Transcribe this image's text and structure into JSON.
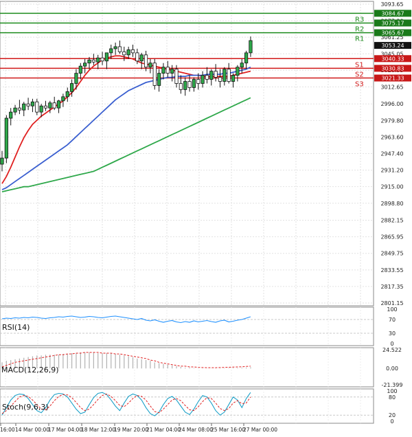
{
  "chart_data": {
    "type": "line",
    "main": {
      "y_axis_ticks": [
        "3093.65",
        "3077.30",
        "3061.25",
        "3045.05",
        "3028.95",
        "3012.65",
        "2996.00",
        "2979.80",
        "2963.60",
        "2947.40",
        "2931.20",
        "2915.00",
        "2898.80",
        "2882.15",
        "2865.95",
        "2849.75",
        "2833.55",
        "2817.35",
        "2801.15"
      ],
      "ylim": [
        2801.15,
        3093.65
      ],
      "current_price": "3053.24",
      "resistance_levels": [
        {
          "label": "R3",
          "value": 3084.67,
          "price_tag": "3084.67"
        },
        {
          "label": "R2",
          "value": 3075.17,
          "price_tag": "3075.17"
        },
        {
          "label": "R1",
          "value": 3065.67,
          "price_tag": "3065.67"
        }
      ],
      "support_levels": [
        {
          "label": "S1",
          "value": 3040.33,
          "price_tag": "3040.33"
        },
        {
          "label": "S2",
          "value": 3030.83,
          "price_tag": "3030.83"
        },
        {
          "label": "S3",
          "value": 3021.33,
          "price_tag": "3021.33"
        }
      ],
      "candles_ohlc": [
        [
          2937,
          2950,
          2930,
          2943
        ],
        [
          2943,
          2985,
          2938,
          2982
        ],
        [
          2982,
          2992,
          2975,
          2988
        ],
        [
          2988,
          2995,
          2985,
          2992
        ],
        [
          2992,
          3000,
          2986,
          2990
        ],
        [
          2990,
          2998,
          2984,
          2996
        ],
        [
          2996,
          3002,
          2990,
          2994
        ],
        [
          2994,
          3001,
          2988,
          2998
        ],
        [
          2998,
          3001,
          2985,
          2988
        ],
        [
          2988,
          2996,
          2983,
          2994
        ],
        [
          2994,
          2999,
          2989,
          2992
        ],
        [
          2992,
          2999,
          2987,
          2997
        ],
        [
          2997,
          3003,
          2990,
          2992
        ],
        [
          2992,
          3000,
          2987,
          2999
        ],
        [
          2999,
          3006,
          2993,
          3003
        ],
        [
          3003,
          3012,
          2998,
          3008
        ],
        [
          3008,
          3020,
          3003,
          3016
        ],
        [
          3016,
          3030,
          3010,
          3026
        ],
        [
          3026,
          3036,
          3020,
          3033
        ],
        [
          3033,
          3040,
          3026,
          3036
        ],
        [
          3036,
          3042,
          3030,
          3039
        ],
        [
          3039,
          3045,
          3034,
          3037
        ],
        [
          3037,
          3044,
          3030,
          3041
        ],
        [
          3041,
          3047,
          3034,
          3038
        ],
        [
          3038,
          3044,
          3030,
          3046
        ],
        [
          3046,
          3054,
          3040,
          3050
        ],
        [
          3050,
          3056,
          3044,
          3052
        ],
        [
          3052,
          3058,
          3045,
          3047
        ],
        [
          3047,
          3052,
          3038,
          3044
        ],
        [
          3044,
          3052,
          3040,
          3049
        ],
        [
          3049,
          3054,
          3042,
          3046
        ],
        [
          3046,
          3050,
          3035,
          3038
        ],
        [
          3038,
          3046,
          3030,
          3044
        ],
        [
          3044,
          3048,
          3028,
          3032
        ],
        [
          3032,
          3040,
          3026,
          3036
        ],
        [
          3036,
          3040,
          3010,
          3014
        ],
        [
          3014,
          3030,
          3008,
          3026
        ],
        [
          3026,
          3036,
          3020,
          3032
        ],
        [
          3032,
          3038,
          3022,
          3026
        ],
        [
          3026,
          3034,
          3018,
          3030
        ],
        [
          3030,
          3034,
          3012,
          3016
        ],
        [
          3016,
          3024,
          3006,
          3010
        ],
        [
          3010,
          3022,
          3004,
          3018
        ],
        [
          3018,
          3024,
          3008,
          3012
        ],
        [
          3012,
          3022,
          3008,
          3020
        ],
        [
          3020,
          3026,
          3010,
          3016
        ],
        [
          3016,
          3028,
          3012,
          3024
        ],
        [
          3024,
          3032,
          3016,
          3020
        ],
        [
          3020,
          3030,
          3014,
          3028
        ],
        [
          3028,
          3035,
          3018,
          3022
        ],
        [
          3022,
          3030,
          3012,
          3018
        ],
        [
          3018,
          3032,
          3014,
          3030
        ],
        [
          3030,
          3036,
          3016,
          3018
        ],
        [
          3018,
          3026,
          3012,
          3024
        ],
        [
          3024,
          3034,
          3018,
          3032
        ],
        [
          3032,
          3040,
          3026,
          3036
        ],
        [
          3036,
          3048,
          3030,
          3046
        ],
        [
          3046,
          3062,
          3042,
          3058
        ]
      ],
      "moving_averages": [
        {
          "color": "#e02020",
          "values": [
            2918,
            2925,
            2934,
            2944,
            2954,
            2963,
            2970,
            2976,
            2980,
            2984,
            2987,
            2990,
            2993,
            2996,
            2999,
            3003,
            3007,
            3012,
            3018,
            3024,
            3029,
            3033,
            3036,
            3039,
            3041,
            3042,
            3043,
            3043,
            3042,
            3041,
            3040,
            3038,
            3036,
            3035,
            3034,
            3033,
            3032,
            3031,
            3030,
            3029,
            3028,
            3027,
            3026,
            3025,
            3024,
            3024,
            3023,
            3023,
            3023,
            3023,
            3023,
            3023,
            3023,
            3024,
            3025,
            3026,
            3027,
            3028
          ]
        },
        {
          "color": "#3a5fd0",
          "values": [
            2912,
            2914,
            2917,
            2920,
            2923,
            2926,
            2929,
            2932,
            2935,
            2938,
            2941,
            2944,
            2947,
            2950,
            2953,
            2956,
            2960,
            2964,
            2968,
            2972,
            2976,
            2980,
            2984,
            2988,
            2992,
            2996,
            3000,
            3003,
            3006,
            3009,
            3011,
            3013,
            3015,
            3017,
            3018,
            3019,
            3020,
            3021,
            3022,
            3022,
            3023,
            3023,
            3023,
            3024,
            3024,
            3024,
            3024,
            3025,
            3025,
            3025,
            3025,
            3026,
            3026,
            3027,
            3028,
            3029,
            3030,
            3032
          ]
        },
        {
          "color": "#2ea84a",
          "values": [
            2910,
            2911,
            2912,
            2913,
            2914,
            2915,
            2915,
            2916,
            2917,
            2918,
            2919,
            2920,
            2921,
            2922,
            2923,
            2924,
            2925,
            2926,
            2927,
            2928,
            2929,
            2930,
            2932,
            2934,
            2936,
            2938,
            2940,
            2942,
            2944,
            2946,
            2948,
            2950,
            2952,
            2954,
            2956,
            2958,
            2960,
            2962,
            2964,
            2966,
            2968,
            2970,
            2972,
            2974,
            2976,
            2978,
            2980,
            2982,
            2984,
            2986,
            2988,
            2990,
            2992,
            2994,
            2996,
            2998,
            3000,
            3002
          ]
        }
      ]
    },
    "x_axis_labels": [
      "16:00",
      "14 Mar 00:00",
      "17 Mar 04:00",
      "18 Mar 12:00",
      "19 Mar 20:00",
      "21 Mar 04:00",
      "24 Mar 08:00",
      "25 Mar 16:00",
      "27 Mar 00:00"
    ],
    "rsi": {
      "title": "RSI(14)",
      "ticks": [
        "100",
        "70",
        "30",
        "0"
      ],
      "values": [
        72,
        74,
        73,
        75,
        74,
        76,
        75,
        77,
        76,
        74,
        73,
        75,
        76,
        78,
        77,
        79,
        80,
        78,
        76,
        77,
        79,
        78,
        76,
        75,
        77,
        79,
        80,
        78,
        76,
        74,
        72,
        70,
        73,
        68,
        66,
        69,
        65,
        62,
        65,
        67,
        63,
        61,
        64,
        62,
        66,
        63,
        65,
        67,
        64,
        62,
        66,
        68,
        63,
        65,
        68,
        70,
        74,
        78
      ],
      "ylim": [
        0,
        100
      ]
    },
    "macd": {
      "title": "MACD(12,26,9)",
      "ticks": [
        "24.522",
        "0.00",
        "-21.399"
      ],
      "histogram": [
        8,
        10,
        11,
        12,
        13,
        14,
        15,
        16,
        17,
        17,
        18,
        18,
        18,
        18,
        19,
        19,
        20,
        20,
        21,
        21,
        21,
        21,
        20,
        20,
        20,
        20,
        19,
        18,
        17,
        16,
        15,
        13,
        12,
        11,
        10,
        8,
        7,
        6,
        5,
        4,
        3,
        2,
        1,
        1,
        0.5,
        0.3,
        0.2,
        0.1,
        0.1,
        0.2,
        0.3,
        0.4,
        0.5,
        0.6,
        0.7,
        0.9,
        1.2,
        1.6
      ],
      "signal": [
        2,
        4,
        6,
        8,
        9,
        10,
        11,
        12,
        13,
        14,
        15,
        16,
        17,
        18,
        18,
        19,
        19,
        20,
        20,
        21,
        21,
        21,
        21,
        20,
        20,
        20,
        19,
        19,
        18,
        17,
        16,
        15,
        14,
        13,
        11,
        10,
        8,
        7,
        6,
        5,
        4,
        3,
        3,
        2,
        2,
        1.5,
        1.2,
        1,
        1,
        1,
        1.2,
        1.4,
        1.6,
        1.8,
        2,
        2.2,
        2.6,
        3
      ],
      "ylim": [
        -21.399,
        24.522
      ]
    },
    "stoch": {
      "title": "Stoch(9,6,3)",
      "ticks": [
        "100",
        "80",
        "20",
        "0"
      ],
      "k": [
        20,
        45,
        70,
        85,
        90,
        88,
        75,
        55,
        35,
        28,
        45,
        70,
        88,
        92,
        90,
        80,
        60,
        40,
        25,
        30,
        55,
        78,
        92,
        95,
        88,
        70,
        50,
        35,
        60,
        82,
        90,
        85,
        70,
        45,
        25,
        18,
        30,
        55,
        75,
        82,
        70,
        50,
        30,
        22,
        40,
        65,
        85,
        80,
        60,
        35,
        20,
        30,
        55,
        80,
        70,
        45,
        75,
        95
      ],
      "d": [
        25,
        35,
        50,
        65,
        80,
        85,
        82,
        70,
        55,
        40,
        38,
        50,
        68,
        82,
        88,
        87,
        78,
        62,
        45,
        35,
        40,
        55,
        72,
        85,
        90,
        82,
        68,
        52,
        48,
        60,
        75,
        85,
        82,
        70,
        50,
        32,
        28,
        40,
        55,
        70,
        75,
        68,
        52,
        38,
        35,
        48,
        65,
        78,
        75,
        60,
        42,
        35,
        42,
        60,
        68,
        58,
        60,
        80
      ],
      "ylim": [
        0,
        100
      ]
    }
  }
}
